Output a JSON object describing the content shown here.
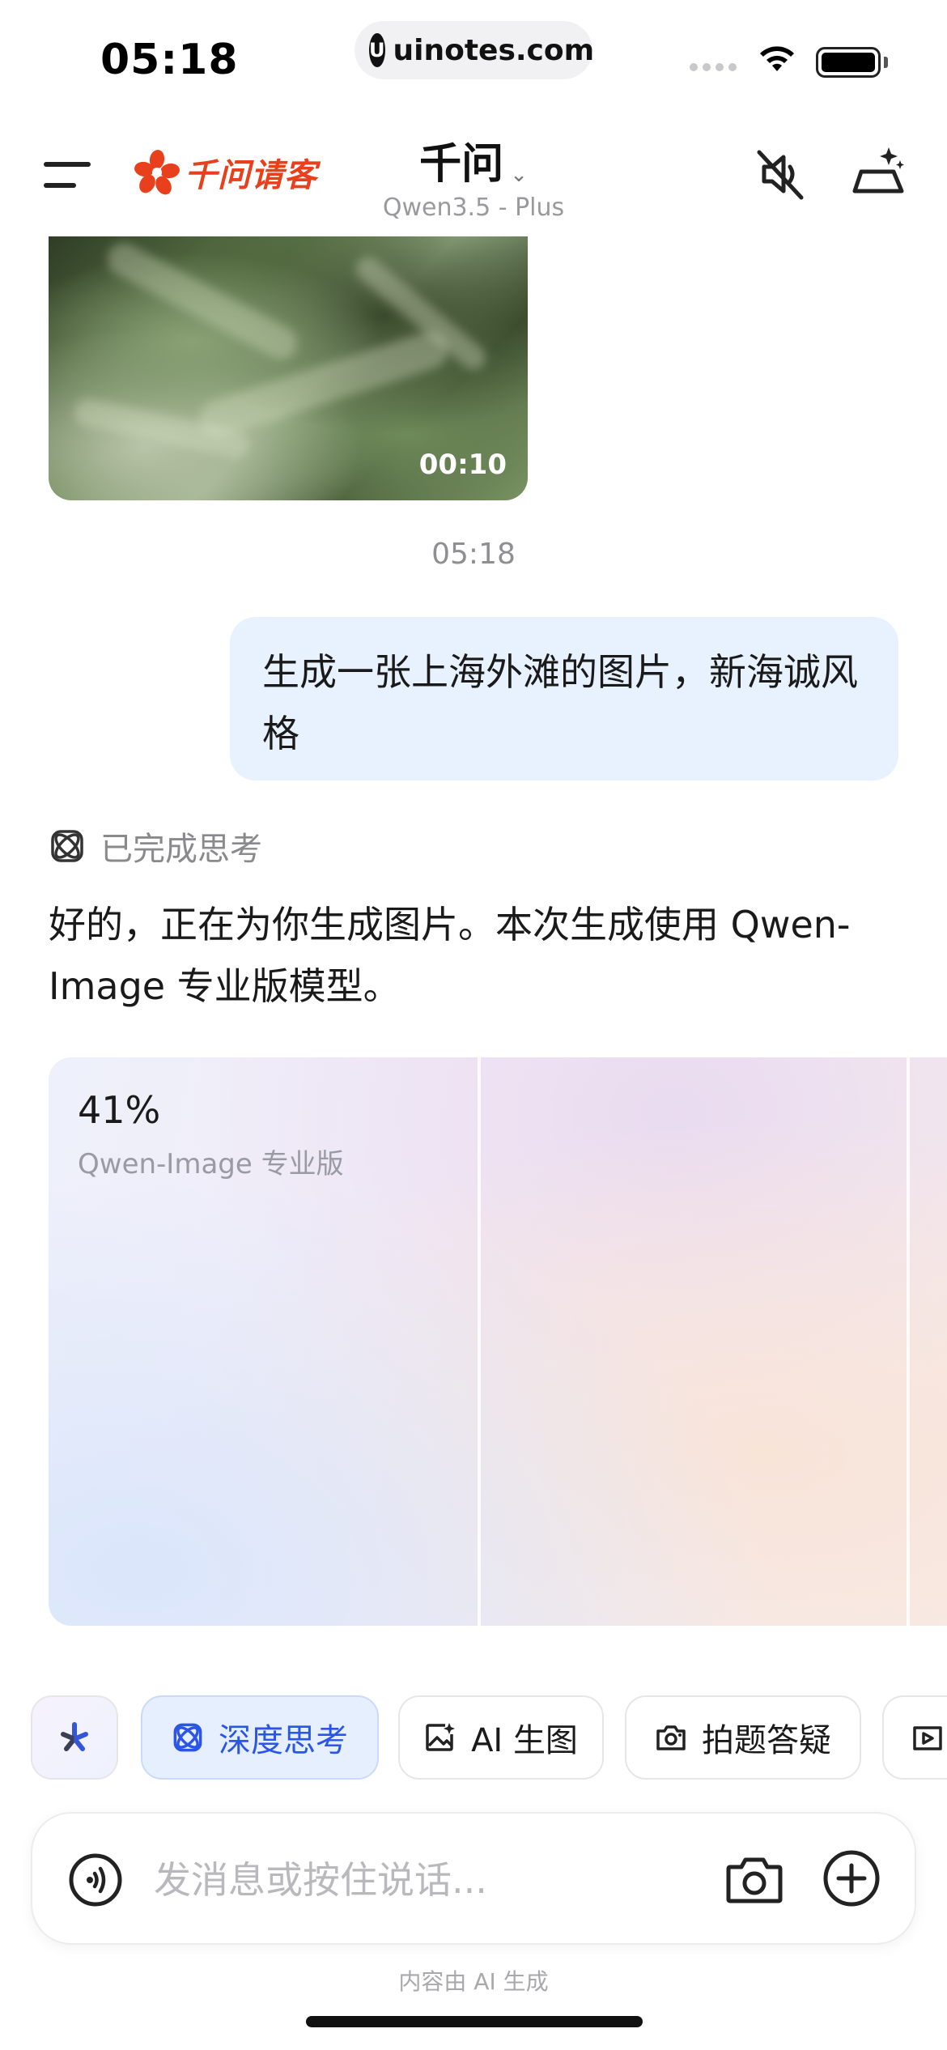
{
  "status_bar": {
    "time": "05:18",
    "url": "uinotes.com",
    "url_logo": "U"
  },
  "header": {
    "brand": "千问请客",
    "title": "千问",
    "title_chevron": "⌄",
    "subtitle": "Qwen3.5 - Plus"
  },
  "conversation": {
    "video_duration": "00:10",
    "message_time": "05:18",
    "user_message": "生成一张上海外滩的图片，新海诚风格",
    "thinking_label": "已完成思考",
    "ai_reply": "好的，正在为你生成图片。本次生成使用 Qwen-Image 专业版模型。",
    "generation": {
      "progress": 0.41,
      "progress_label": "41%",
      "model": "Qwen-Image 专业版"
    }
  },
  "chips": [
    {
      "label": "",
      "icon": "spark-icon"
    },
    {
      "label": "深度思考",
      "icon": "deep-think-icon",
      "active": true
    },
    {
      "label": "AI 生图",
      "icon": "image-gen-icon"
    },
    {
      "label": "拍题答疑",
      "icon": "camera-question-icon"
    },
    {
      "label": "",
      "icon": "video-gen-icon"
    }
  ],
  "input": {
    "placeholder": "发消息或按住说话..."
  },
  "disclaimer": "内容由 AI 生成",
  "colors": {
    "brand": "#e8401c",
    "accent": "#2a55e6",
    "user_bubble": "#e8f2fe",
    "chip_active_bg": "#e6effe"
  }
}
